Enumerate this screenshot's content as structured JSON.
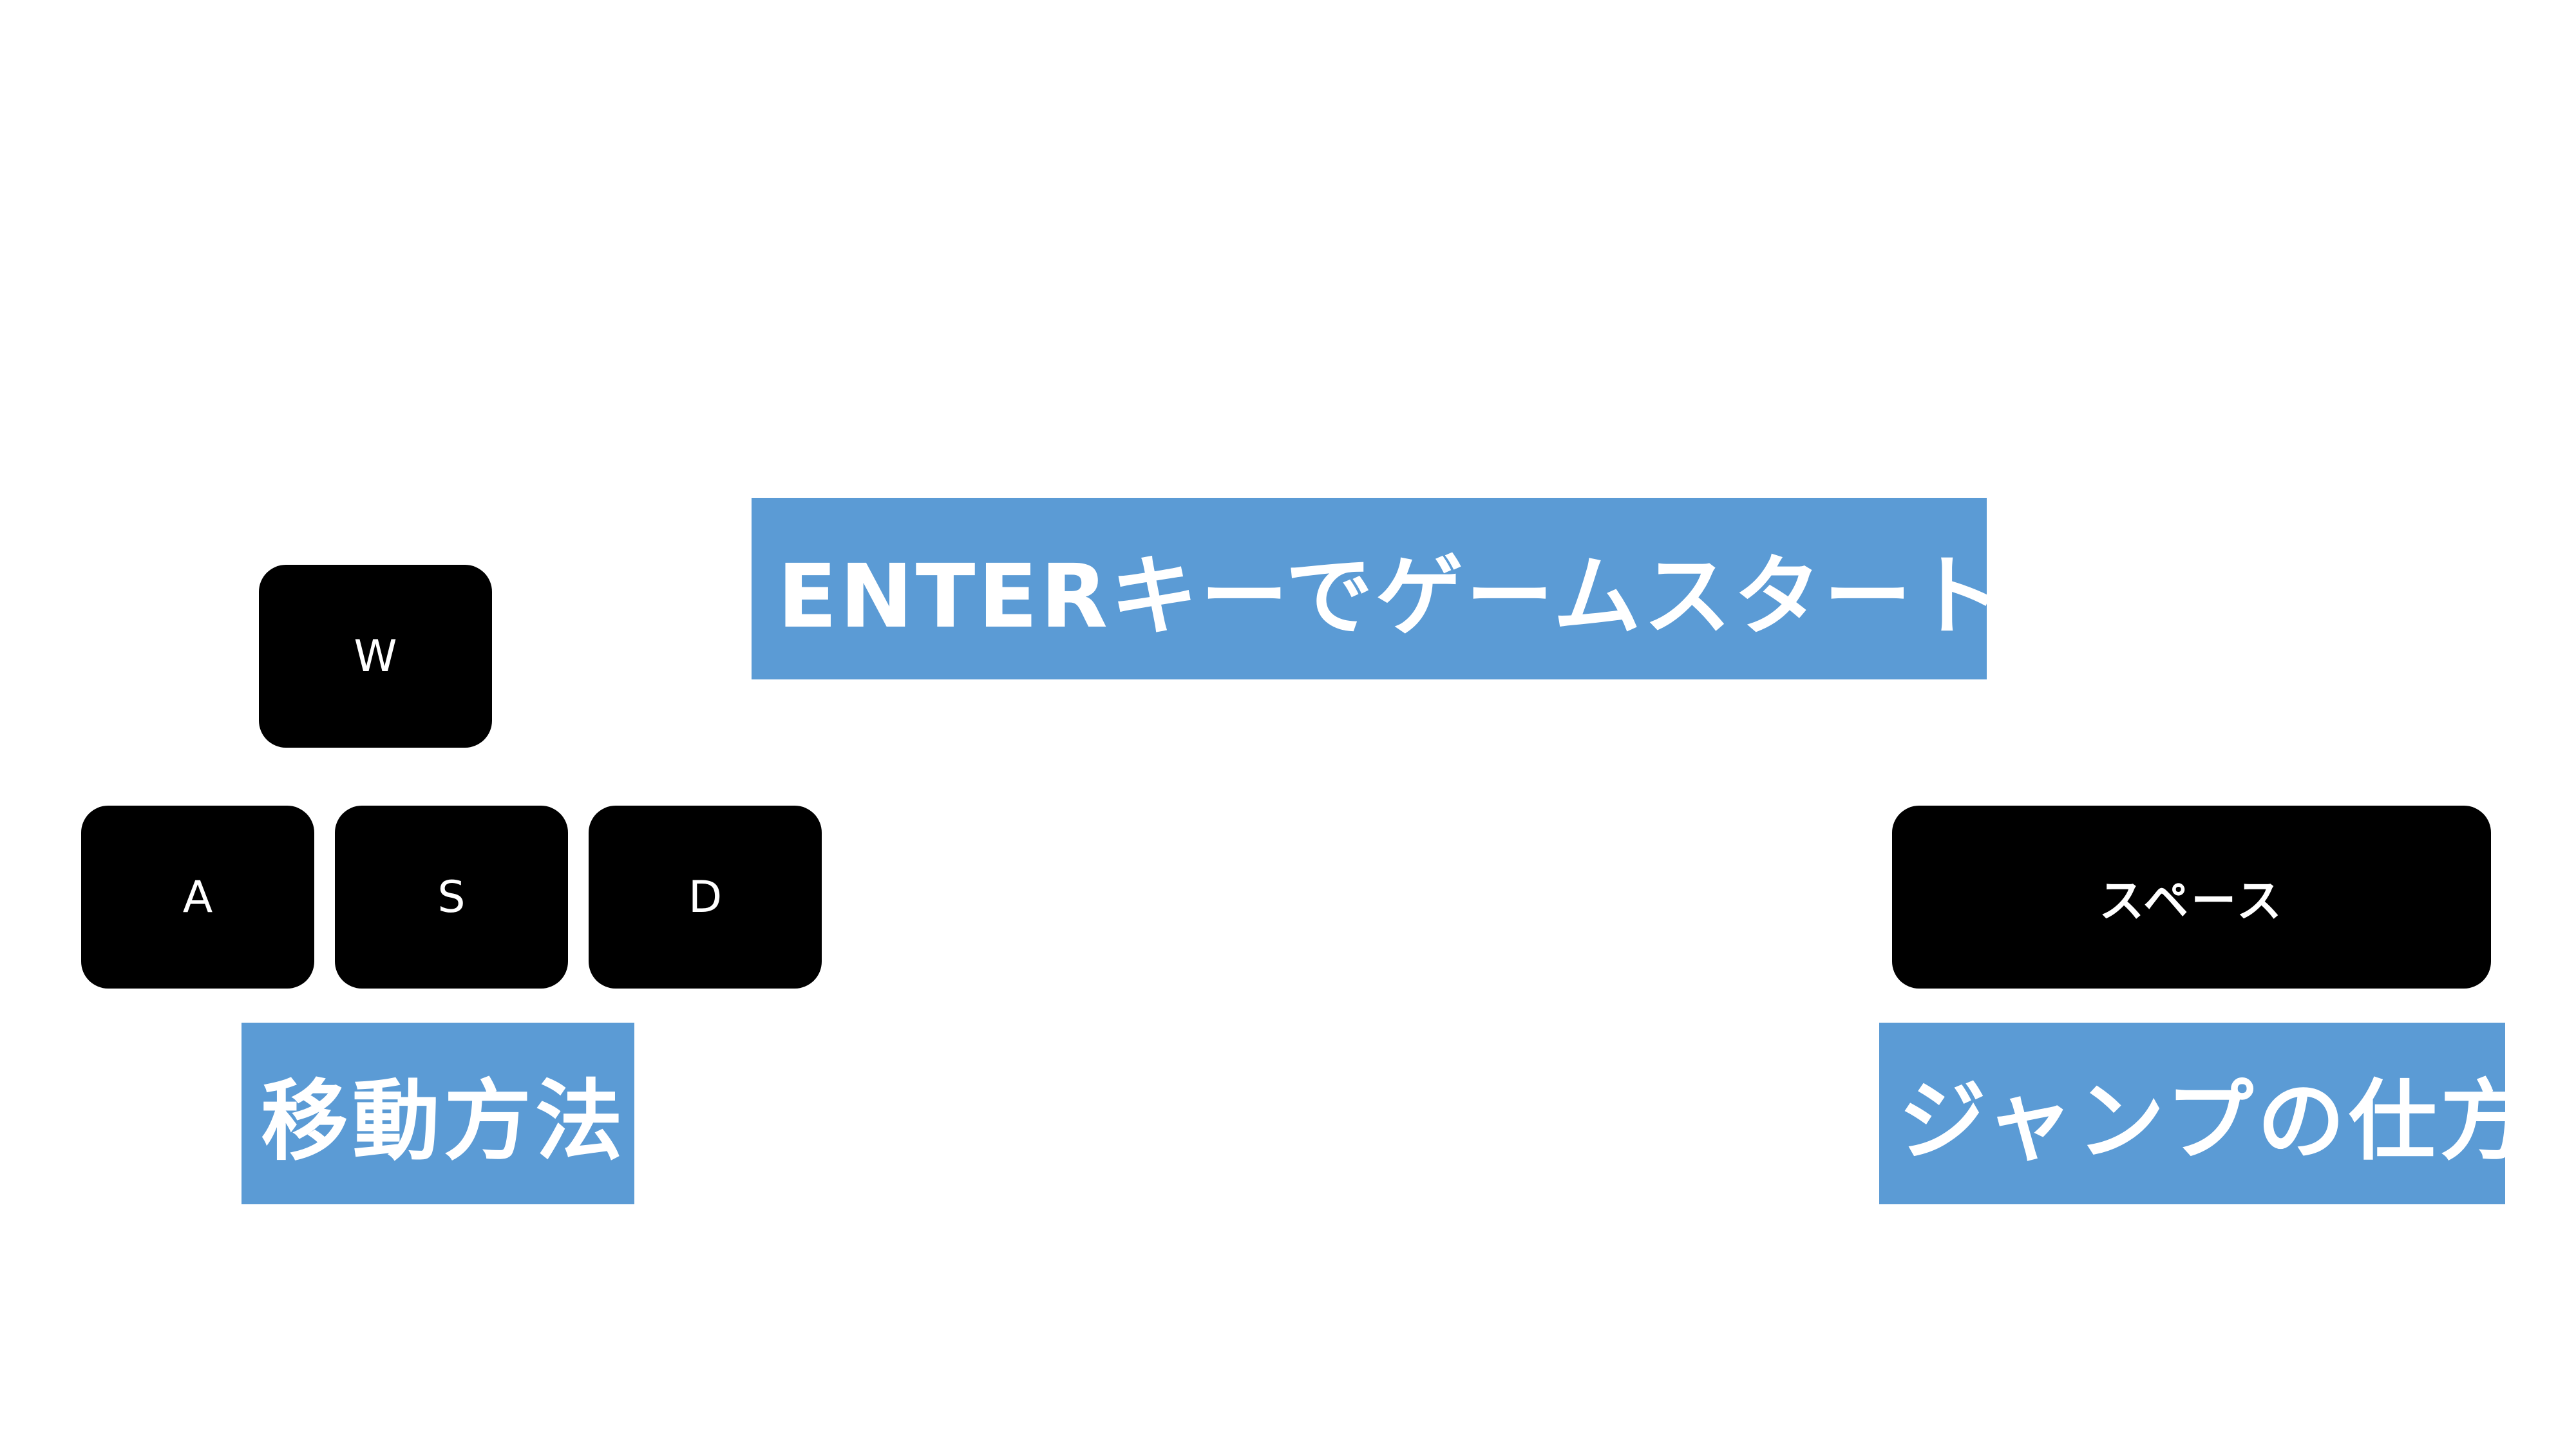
{
  "start_prompt": "ENTERキーでゲームスタート!!",
  "movement": {
    "label": "移動方法",
    "keys": [
      "W",
      "A",
      "S",
      "D"
    ]
  },
  "jump": {
    "label": "ジャンプの仕方",
    "key": "スペース"
  },
  "colors": {
    "banner": "#5b9bd5",
    "key_background": "#000000",
    "key_text": "#ffffff",
    "background": "#ffffff"
  }
}
